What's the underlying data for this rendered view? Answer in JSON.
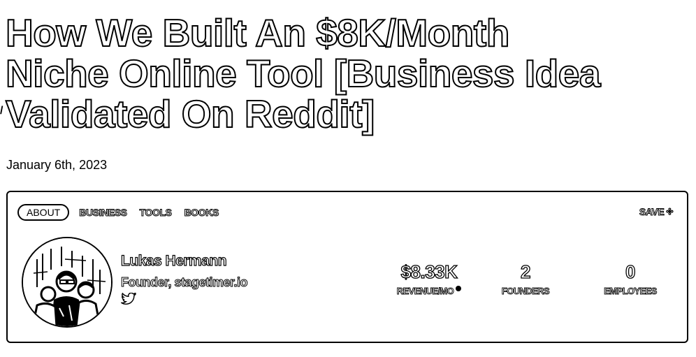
{
  "article": {
    "title_lines": [
      "How We Built An $8K/Month",
      "Niche Online Tool [Business Idea",
      "Validated On Reddit]"
    ],
    "date": "January 6th, 2023"
  },
  "card": {
    "tabs": [
      {
        "label": "ABOUT",
        "active": true
      },
      {
        "label": "BUSINESS",
        "active": false
      },
      {
        "label": "TOOLS",
        "active": false
      },
      {
        "label": "BOOKS",
        "active": false
      }
    ],
    "save_label": "SAVE",
    "save_icon": "bookmark-plus-icon",
    "founder": {
      "name": "Lukas Hermann",
      "role": "Founder, stagetimer.io",
      "social_icon": "twitter-icon"
    },
    "stats": [
      {
        "value": "$8.33K",
        "label": "REVENUE/MO",
        "info_icon": true
      },
      {
        "value": "2",
        "label": "FOUNDERS",
        "info_icon": false
      },
      {
        "value": "0",
        "label": "EMPLOYEES",
        "info_icon": false
      }
    ]
  }
}
